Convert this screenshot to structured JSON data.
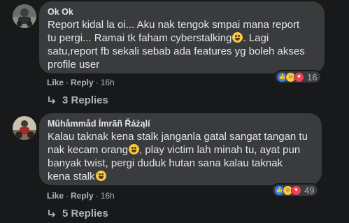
{
  "comments": [
    {
      "author": "Ok Ok",
      "lines": [
        "Report kidal la oi... Aku nak tengok smpai mana report",
        "tu pergi... Ramai tk faham cyberstalking",
        "satu,report fb sekali sebab ada features yg boleh akses",
        "profile user"
      ],
      "line2_suffix": ". Lagi",
      "reaction_count": "16",
      "actions": {
        "like": "Like",
        "reply": "Reply",
        "time": "16h"
      },
      "replies": "3 Replies"
    },
    {
      "author": "Mûhåmmåd Ímrāñ Řáżąlí",
      "lines": [
        "Kalau taknak kena stalk janganla gatal sangat tangan tu",
        "nak kecam orang",
        "banyak twist, pergi duduk hutan sana kalau taknak",
        "kena stalk"
      ],
      "line2_suffix": ", play victim lah minah tu, ayat pun",
      "reaction_count": "49",
      "actions": {
        "like": "Like",
        "reply": "Reply",
        "time": "16h"
      },
      "replies": "5 Replies"
    }
  ],
  "colors": {
    "background": "#18191a",
    "bubble": "#3a3b3c",
    "text": "#e4e6eb",
    "muted": "#b0b3b8",
    "like_blue": "#2d88ff",
    "love_red": "#f33e58",
    "haha_yellow": "#f7c843"
  },
  "icons": {
    "reactions": [
      "like-icon",
      "haha-icon",
      "love-icon"
    ],
    "reply_arrow": "reply-arrow-icon"
  }
}
